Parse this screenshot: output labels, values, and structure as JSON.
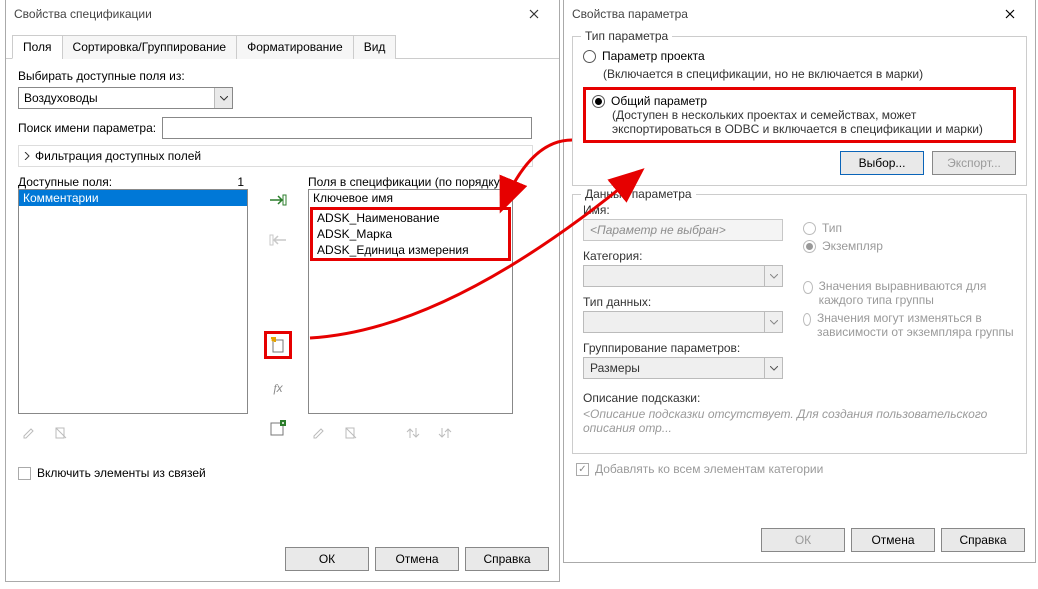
{
  "dlg1": {
    "title": "Свойства спецификации",
    "tabs": [
      "Поля",
      "Сортировка/Группирование",
      "Форматирование",
      "Вид"
    ],
    "active_tab": 0,
    "select_from_label": "Выбирать доступные поля из:",
    "category": "Воздуховоды",
    "search_label": "Поиск имени параметра:",
    "filter_label": "Фильтрация доступных полей",
    "available_label": "Доступные поля:",
    "available_count": "1",
    "available_items": [
      "Комментарии"
    ],
    "scheduled_label": "Поля в спецификации (по порядку):",
    "scheduled_items": [
      "Ключевое имя",
      "ADSK_Наименование",
      "ADSK_Марка",
      "ADSK_Единица измерения"
    ],
    "include_linked": "Включить элементы из связей",
    "buttons": {
      "ok": "ОК",
      "cancel": "Отмена",
      "help": "Справка"
    }
  },
  "dlg2": {
    "title": "Свойства параметра",
    "type_group": "Тип параметра",
    "opt_project": "Параметр проекта",
    "opt_project_desc": "(Включается в спецификации, но не включается в марки)",
    "opt_shared": "Общий параметр",
    "opt_shared_desc": "(Доступен в нескольких проектах и семействах, может экспортироваться в ODBC и включается в спецификации и марки)",
    "btn_select": "Выбор...",
    "btn_export": "Экспорт...",
    "data_group": "Данные параметра",
    "name_label": "Имя:",
    "name_placeholder": "<Параметр не выбран>",
    "category_label": "Категория:",
    "datatype_label": "Тип данных:",
    "group_label": "Группирование параметров:",
    "group_value": "Размеры",
    "radio_type": "Тип",
    "radio_instance": "Экземпляр",
    "radio_align_group": "Значения выравниваются для каждого типа группы",
    "radio_vary_group": "Значения могут изменяться в зависимости от экземпляра группы",
    "tooltip_label": "Описание подсказки:",
    "tooltip_placeholder": "<Описание подсказки отсутствует. Для создания пользовательского описания отр...",
    "add_to_all": "Добавлять ко всем элементам категории",
    "buttons": {
      "ok": "ОК",
      "cancel": "Отмена",
      "help": "Справка"
    }
  }
}
